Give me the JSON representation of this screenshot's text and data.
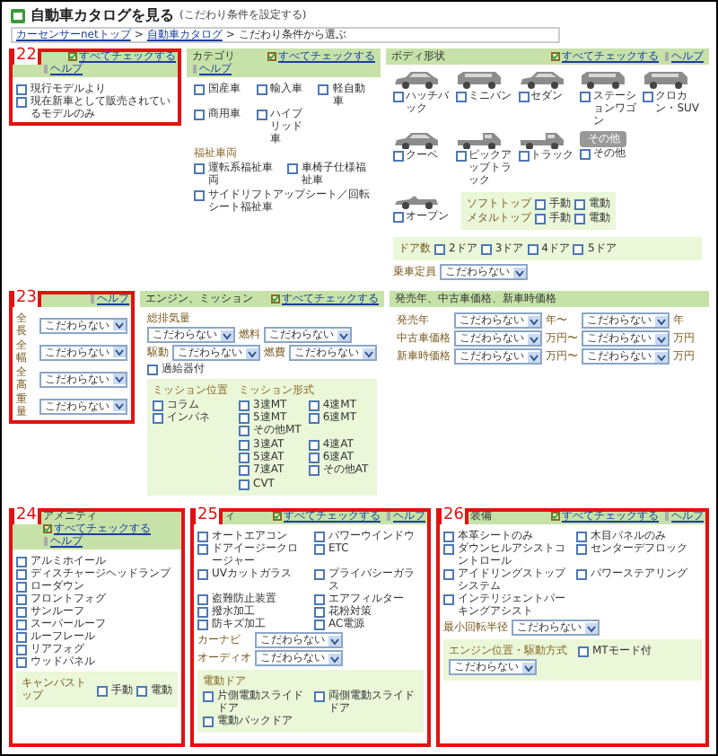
{
  "header": {
    "title": "自動車カタログを見る",
    "subtitle": "(こだわり条件を設定する)"
  },
  "breadcrumb": [
    {
      "kind": "link",
      "text": "カーセンサーnetトップ"
    },
    {
      "kind": "sep",
      "text": ">"
    },
    {
      "kind": "link",
      "text": "自動車カタログ"
    },
    {
      "kind": "sep",
      "text": ">"
    },
    {
      "kind": "current",
      "text": "こだわり条件から選ぶ"
    }
  ],
  "rows": [
    {
      "panels": [
        {
          "callout": "22",
          "check_all": "すべてチェックする",
          "help": "ヘルプ",
          "blocks": [
            {
              "kind": "checks",
              "rows": [
                [
                  {
                    "label": "現行モデルより",
                    "checked": false
                  }
                ],
                [
                  {
                    "label": "現在新車として販売されているモデルのみ",
                    "checked": false
                  }
                ]
              ]
            }
          ]
        },
        {
          "title": "カテゴリ",
          "check_all": "すべてチェックする",
          "help": "ヘルプ",
          "blocks": [
            {
              "kind": "checks",
              "rows": [
                [
                  {
                    "label": "国産車",
                    "checked": false
                  },
                  {
                    "label": "輸入車",
                    "checked": false
                  },
                  {
                    "label": "軽自動車",
                    "checked": false
                  }
                ],
                [
                  {
                    "label": "商用車",
                    "checked": false
                  },
                  {
                    "label": "ハイブリッド車",
                    "checked": false
                  }
                ]
              ]
            },
            {
              "kind": "heading",
              "text": "福祉車両"
            },
            {
              "kind": "checks",
              "rows": [
                [
                  {
                    "label": "運転系福祉車両",
                    "checked": false
                  },
                  {
                    "label": "車椅子仕様福祉車",
                    "checked": false
                  }
                ]
              ]
            },
            {
              "kind": "checks",
              "rows": [
                [
                  {
                    "label": "サイドリフトアップシート／回転シート福祉車",
                    "checked": false
                  }
                ]
              ]
            }
          ]
        },
        {
          "title": "ボディ形状",
          "check_all": "すべてチェックする",
          "help": "ヘルプ",
          "blocks": [
            {
              "kind": "cars",
              "items": [
                {
                  "label": "ハッチバック",
                  "checked": false
                },
                {
                  "label": "ミニバン",
                  "checked": false
                },
                {
                  "label": "セダン",
                  "checked": false
                },
                {
                  "label": "ステーションワゴン",
                  "checked": false
                },
                {
                  "label": "クロカン・SUV",
                  "checked": false
                },
                {
                  "label": "クーペ",
                  "checked": false
                },
                {
                  "label": "ピックアップトラック",
                  "checked": false
                },
                {
                  "label": "トラック",
                  "checked": false
                },
                {
                  "label": "その他",
                  "checked": false,
                  "icon_text": "その他"
                }
              ]
            },
            {
              "kind": "columns",
              "columns": [
                [
                  {
                    "kind": "cars",
                    "items": [
                      {
                        "label": "オープン",
                        "checked": false
                      }
                    ]
                  }
                ],
                [
                  {
                    "kind": "box",
                    "blocks": [
                      {
                        "kind": "fields",
                        "rows": [
                          [
                            {
                              "kind": "label",
                              "text": "ソフトトップ"
                            },
                            {
                              "kind": "check",
                              "label": "手動",
                              "checked": false
                            },
                            {
                              "kind": "check",
                              "label": "電動",
                              "checked": false
                            }
                          ],
                          [
                            {
                              "kind": "label",
                              "text": "メタルトップ"
                            },
                            {
                              "kind": "check",
                              "label": "手動",
                              "checked": false
                            },
                            {
                              "kind": "check",
                              "label": "電動",
                              "checked": false
                            }
                          ]
                        ]
                      }
                    ]
                  }
                ]
              ]
            },
            {
              "kind": "box",
              "blocks": [
                {
                  "kind": "fields",
                  "rows": [
                    [
                      {
                        "kind": "label",
                        "text": "ドア数"
                      },
                      {
                        "kind": "check",
                        "label": "2ドア",
                        "checked": false
                      },
                      {
                        "kind": "check",
                        "label": "3ドア",
                        "checked": false
                      },
                      {
                        "kind": "check",
                        "label": "4ドア",
                        "checked": false
                      },
                      {
                        "kind": "check",
                        "label": "5ドア",
                        "checked": false
                      }
                    ]
                  ]
                }
              ]
            },
            {
              "kind": "fields",
              "rows": [
                [
                  {
                    "kind": "label",
                    "text": "乗車定員"
                  },
                  {
                    "kind": "select",
                    "value": "こだわらない"
                  }
                ]
              ]
            }
          ]
        }
      ]
    },
    {
      "panels": [
        {
          "callout": "23",
          "help": "ヘルプ",
          "blocks": [
            {
              "kind": "fields",
              "rows": [
                [
                  {
                    "kind": "label",
                    "text": "全長"
                  },
                  {
                    "kind": "select",
                    "value": "こだわらない"
                  }
                ],
                [
                  {
                    "kind": "label",
                    "text": "全幅"
                  },
                  {
                    "kind": "select",
                    "value": "こだわらない"
                  }
                ],
                [
                  {
                    "kind": "label",
                    "text": "全高"
                  },
                  {
                    "kind": "select",
                    "value": "こだわらない"
                  }
                ],
                [
                  {
                    "kind": "label",
                    "text": "重量"
                  },
                  {
                    "kind": "select",
                    "value": "こだわらない"
                  }
                ]
              ]
            }
          ]
        },
        {
          "title": "エンジン、ミッション",
          "check_all": "すべてチェックする",
          "blocks": [
            {
              "kind": "fields",
              "rows": [
                [
                  {
                    "kind": "label",
                    "text": "総排気量"
                  }
                ],
                [
                  {
                    "kind": "select",
                    "value": "こだわらない"
                  },
                  {
                    "kind": "label",
                    "text": "燃料"
                  },
                  {
                    "kind": "select",
                    "value": "こだわらない"
                  }
                ],
                [
                  {
                    "kind": "label",
                    "text": "駆動"
                  },
                  {
                    "kind": "select",
                    "value": "こだわらない"
                  },
                  {
                    "kind": "label",
                    "text": "燃費"
                  },
                  {
                    "kind": "select",
                    "value": "こだわらない"
                  }
                ],
                [
                  {
                    "kind": "check",
                    "label": "過給器付",
                    "checked": false
                  }
                ]
              ]
            },
            {
              "kind": "box",
              "blocks": [
                {
                  "kind": "columns",
                  "columns": [
                    [
                      {
                        "kind": "heading",
                        "text": "ミッション位置"
                      },
                      {
                        "kind": "checks",
                        "rows": [
                          [
                            {
                              "label": "コラム",
                              "checked": false
                            }
                          ],
                          [
                            {
                              "label": "インパネ",
                              "checked": false
                            }
                          ]
                        ]
                      }
                    ],
                    [
                      {
                        "kind": "heading",
                        "text": "ミッション形式"
                      },
                      {
                        "kind": "checks",
                        "rows": [
                          [
                            {
                              "label": "3速MT",
                              "checked": false
                            },
                            {
                              "label": "4速MT",
                              "checked": false
                            }
                          ],
                          [
                            {
                              "label": "5速MT",
                              "checked": false
                            },
                            {
                              "label": "6速MT",
                              "checked": false
                            }
                          ],
                          [
                            {
                              "label": "その他MT",
                              "checked": false
                            }
                          ]
                        ]
                      },
                      {
                        "kind": "checks",
                        "rows": [
                          [
                            {
                              "label": "3速AT",
                              "checked": false
                            },
                            {
                              "label": "4速AT",
                              "checked": false
                            }
                          ],
                          [
                            {
                              "label": "5速AT",
                              "checked": false
                            },
                            {
                              "label": "6速AT",
                              "checked": false
                            }
                          ],
                          [
                            {
                              "label": "7速AT",
                              "checked": false
                            },
                            {
                              "label": "その他AT",
                              "checked": false
                            }
                          ]
                        ]
                      },
                      {
                        "kind": "checks",
                        "rows": [
                          [
                            {
                              "label": "CVT",
                              "checked": false
                            }
                          ]
                        ]
                      }
                    ]
                  ]
                }
              ]
            }
          ]
        },
        {
          "title": "発売年、中古車価格、新車時価格",
          "blocks": [
            {
              "kind": "fields",
              "rows": [
                [
                  {
                    "kind": "label",
                    "text": "発売年"
                  },
                  {
                    "kind": "select",
                    "value": "こだわらない"
                  },
                  {
                    "kind": "unit",
                    "text": "年〜"
                  },
                  {
                    "kind": "select",
                    "value": "こだわらない"
                  },
                  {
                    "kind": "unit",
                    "text": "年"
                  }
                ],
                [
                  {
                    "kind": "label",
                    "text": "中古車価格"
                  },
                  {
                    "kind": "select",
                    "value": "こだわらない"
                  },
                  {
                    "kind": "unit",
                    "text": "万円〜"
                  },
                  {
                    "kind": "select",
                    "value": "こだわらない"
                  },
                  {
                    "kind": "unit",
                    "text": "万円"
                  }
                ],
                [
                  {
                    "kind": "label",
                    "text": "新車時価格"
                  },
                  {
                    "kind": "select",
                    "value": "こだわらない"
                  },
                  {
                    "kind": "unit",
                    "text": "万円〜"
                  },
                  {
                    "kind": "select",
                    "value": "こだわらない"
                  },
                  {
                    "kind": "unit",
                    "text": "万円"
                  }
                ]
              ]
            }
          ]
        }
      ]
    },
    {
      "panels": [
        {
          "callout": "24",
          "title": "アメニティ",
          "check_all": "すべてチェックする",
          "help": "ヘルプ",
          "blocks": [
            {
              "kind": "checks",
              "rows": [
                [
                  {
                    "label": "アルミホイール",
                    "checked": false
                  }
                ],
                [
                  {
                    "label": "ディスチャージヘッドランプ",
                    "checked": false
                  }
                ],
                [
                  {
                    "label": "ローダウン",
                    "checked": false
                  }
                ],
                [
                  {
                    "label": "フロントフォグ",
                    "checked": false
                  }
                ],
                [
                  {
                    "label": "サンルーフ",
                    "checked": false
                  }
                ],
                [
                  {
                    "label": "スーパールーフ",
                    "checked": false
                  }
                ],
                [
                  {
                    "label": "ルーフレール",
                    "checked": false
                  }
                ],
                [
                  {
                    "label": "リアフォグ",
                    "checked": false
                  }
                ],
                [
                  {
                    "label": "ウッドパネル",
                    "checked": false
                  }
                ]
              ]
            },
            {
              "kind": "box",
              "blocks": [
                {
                  "kind": "fields",
                  "rows": [
                    [
                      {
                        "kind": "label",
                        "text": "キャンバストップ"
                      },
                      {
                        "kind": "check",
                        "label": "手動",
                        "checked": false
                      },
                      {
                        "kind": "check",
                        "label": "電動",
                        "checked": false
                      }
                    ]
                  ]
                }
              ]
            }
          ]
        },
        {
          "callout": "25",
          "title": "ィ",
          "check_all": "すべてチェックする",
          "help": "ヘルプ",
          "blocks": [
            {
              "kind": "checks",
              "rows": [
                [
                  {
                    "label": "オートエアコン",
                    "checked": false
                  },
                  {
                    "label": "パワーウインドウ",
                    "checked": false
                  }
                ],
                [
                  {
                    "label": "ドアイージークロージャー",
                    "checked": false
                  },
                  {
                    "label": "ETC",
                    "checked": false
                  }
                ],
                [
                  {
                    "label": "UVカットガラス",
                    "checked": false
                  },
                  {
                    "label": "プライバシーガラス",
                    "checked": false
                  }
                ],
                [
                  {
                    "label": "盗難防止装置",
                    "checked": false
                  },
                  {
                    "label": "エアフィルター",
                    "checked": false
                  }
                ],
                [
                  {
                    "label": "撥水加工",
                    "checked": false
                  },
                  {
                    "label": "花粉対策",
                    "checked": false
                  }
                ],
                [
                  {
                    "label": "防キズ加工",
                    "checked": false
                  },
                  {
                    "label": "AC電源",
                    "checked": false
                  }
                ]
              ]
            },
            {
              "kind": "fields",
              "rows": [
                [
                  {
                    "kind": "label",
                    "text": "カーナビ"
                  },
                  {
                    "kind": "select",
                    "value": "こだわらない"
                  }
                ],
                [
                  {
                    "kind": "label",
                    "text": "オーディオ"
                  },
                  {
                    "kind": "select",
                    "value": "こだわらない"
                  }
                ]
              ]
            },
            {
              "kind": "box",
              "blocks": [
                {
                  "kind": "heading",
                  "text": "電動ドア"
                },
                {
                  "kind": "checks",
                  "rows": [
                    [
                      {
                        "label": "片側電動スライドドア",
                        "checked": false
                      },
                      {
                        "label": "両側電動スライドドア",
                        "checked": false
                      }
                    ],
                    [
                      {
                        "label": "電動バックドア",
                        "checked": false
                      }
                    ]
                  ]
                }
              ]
            }
          ]
        },
        {
          "callout": "26",
          "title": "装備",
          "check_all": "すべてチェックする",
          "help": "ヘルプ",
          "blocks": [
            {
              "kind": "checks",
              "rows": [
                [
                  {
                    "label": "本革シートのみ",
                    "checked": false
                  },
                  {
                    "label": "木目パネルのみ",
                    "checked": false
                  }
                ],
                [
                  {
                    "label": "ダウンヒルアシストコントロール",
                    "checked": false
                  },
                  {
                    "label": "センターデフロック",
                    "checked": false
                  }
                ],
                [
                  {
                    "label": "アイドリングストップシステム",
                    "checked": false
                  },
                  {
                    "label": "パワーステアリング",
                    "checked": false
                  }
                ],
                [
                  {
                    "label": "インテリジェントパーキングアシスト",
                    "checked": false
                  }
                ]
              ]
            },
            {
              "kind": "fields",
              "rows": [
                [
                  {
                    "kind": "label",
                    "text": "最小回転半径"
                  },
                  {
                    "kind": "select",
                    "value": "こだわらない"
                  }
                ]
              ]
            },
            {
              "kind": "box",
              "blocks": [
                {
                  "kind": "columns",
                  "columns": [
                    [
                      {
                        "kind": "heading",
                        "text": "エンジン位置・駆動方式"
                      },
                      {
                        "kind": "fields",
                        "rows": [
                          [
                            {
                              "kind": "select",
                              "value": "こだわらない"
                            }
                          ]
                        ]
                      }
                    ],
                    [
                      {
                        "kind": "checks",
                        "rows": [
                          [
                            {
                              "label": "MTモード付",
                              "checked": false
                            }
                          ]
                        ]
                      }
                    ]
                  ]
                }
              ]
            }
          ]
        }
      ]
    }
  ]
}
